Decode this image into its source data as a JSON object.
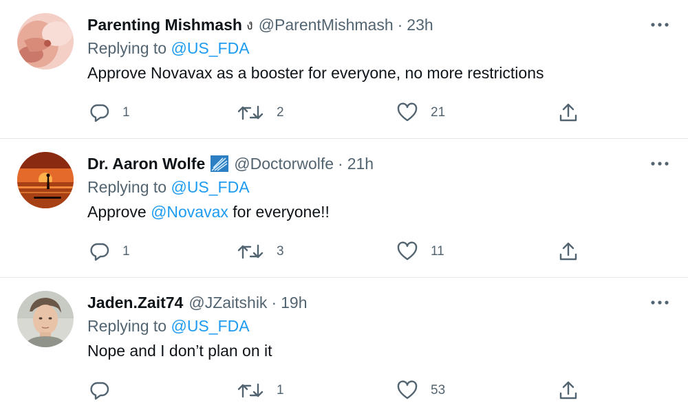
{
  "colors": {
    "link": "#1d9bf0",
    "secondary_text": "#536471",
    "primary_text": "#0f1419",
    "divider": "#e6e9eb"
  },
  "tweets": [
    {
      "display_name": "Parenting Mishmash",
      "name_emoji": "ง",
      "handle": "@ParentMishmash",
      "separator": "·",
      "time": "23h",
      "replying_prefix": "Replying to",
      "replying_to": "@US_FDA",
      "text_before": "Approve Novavax as a booster for everyone, no more restrictions",
      "mention": "",
      "text_after": "",
      "replies": "1",
      "retweets": "2",
      "likes": "21",
      "avatar_icon": "hand-photo-avatar"
    },
    {
      "display_name": "Dr. Aaron Wolfe",
      "verified_icon": "blue-badge-icon",
      "handle": "@Doctorwolfe",
      "separator": "·",
      "time": "21h",
      "replying_prefix": "Replying to",
      "replying_to": "@US_FDA",
      "text_before": "Approve",
      "mention": "@Novavax",
      "text_after": "for everyone!!",
      "replies": "1",
      "retweets": "3",
      "likes": "11",
      "avatar_icon": "sunset-paddleboard-avatar"
    },
    {
      "display_name": "Jaden.Zait74",
      "handle": "@JZaitshik",
      "separator": "·",
      "time": "19h",
      "replying_prefix": "Replying to",
      "replying_to": "@US_FDA",
      "text_before": "Nope and I don’t plan on it",
      "mention": "",
      "text_after": "",
      "replies": "",
      "retweets": "1",
      "likes": "53",
      "avatar_icon": "person-photo-avatar"
    }
  ]
}
